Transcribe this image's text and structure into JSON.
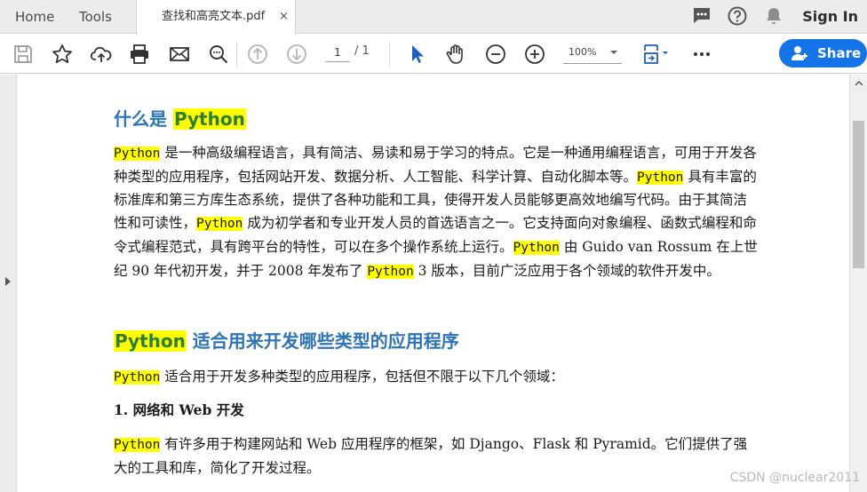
{
  "tabs": {
    "home": "Home",
    "tools": "Tools",
    "document": "查找和高亮文本.pdf",
    "close": "×"
  },
  "header": {
    "sign_in": "Sign In",
    "icons": [
      "chat-icon",
      "help-icon",
      "notification-bell-icon"
    ]
  },
  "toolbar": {
    "icons": [
      "save-icon",
      "bookmark-star-icon",
      "upload-cloud-icon",
      "print-icon",
      "email-icon",
      "find-icon",
      "previous-page-icon",
      "next-page-icon",
      "select-cursor-icon",
      "hand-pan-icon",
      "zoom-out-icon",
      "zoom-in-icon",
      "fit-page-icon",
      "more-icon"
    ],
    "page_current": "1",
    "page_total": "/ 1",
    "zoom": "100%",
    "share_label": "Share"
  },
  "document": {
    "heading1": {
      "prefix": "什么是 ",
      "highlight": "Python"
    },
    "para1": [
      {
        "t": "Python",
        "hl": true
      },
      {
        "t": " 是一种高级编程语言，具有简洁、易读和易于学习的特点。它是一种通用编程语言，可用于开发各种类型的应用程序，包括网站开发、数据分析、人工智能、科学计算、自动化脚本等。"
      },
      {
        "t": "Python",
        "hl": true
      },
      {
        "t": " 具有丰富的标准库和第三方库生态系统，提供了各种功能和工具，使得开发人员能够更高效地编写代码。由于其简洁性和可读性，"
      },
      {
        "t": "Python",
        "hl": true
      },
      {
        "t": " 成为初学者和专业开发人员的首选语言之一。它支持面向对象编程、函数式编程和命令式编程范式，具有跨平台的特性，可以在多个操作系统上运行。"
      },
      {
        "t": "Python",
        "hl": true
      },
      {
        "t": " 由 Guido van Rossum 在上世纪 90 年代初开发，并于 2008 年发布了 "
      },
      {
        "t": "Python",
        "hl": true
      },
      {
        "t": " 3 版本，目前广泛应用于各个领域的软件开发中。"
      }
    ],
    "heading2": {
      "highlight": "Python",
      "suffix": " 适合用来开发哪些类型的应用程序"
    },
    "para2": [
      {
        "t": "Python",
        "hl": true
      },
      {
        "t": " 适合用于开发多种类型的应用程序，包括但不限于以下几个领域："
      }
    ],
    "list_item_1": "1.  网络和 Web 开发",
    "para3": [
      {
        "t": "Python",
        "hl": true
      },
      {
        "t": " 有许多用于构建网站和 Web 应用程序的框架，如 Django、Flask 和 Pyramid。它们提供了强大的工具和库，简化了开发过程。"
      }
    ]
  },
  "watermark": "CSDN @nuclear2011",
  "colors": {
    "accent": "#1473e6",
    "heading": "#2e74b5",
    "highlight": "#ffff00",
    "highlight_text": "#2e7d32"
  }
}
